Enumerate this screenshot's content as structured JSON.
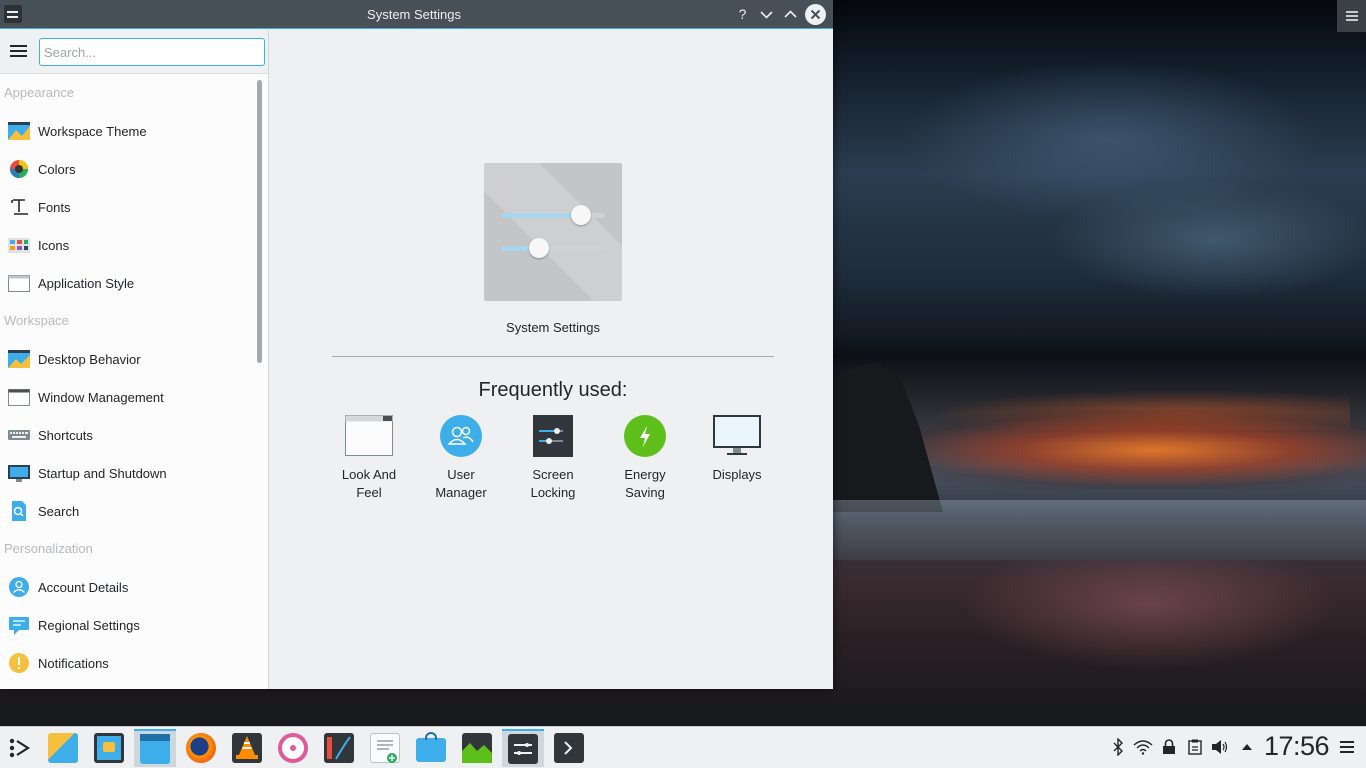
{
  "window": {
    "title": "System Settings",
    "help_glyph": "?",
    "minimize_glyph": "⌄",
    "maximize_glyph": "⌃",
    "close_glyph": "✕"
  },
  "sidebar": {
    "search_placeholder": "Search...",
    "categories": [
      {
        "label": "Appearance",
        "items": [
          "Workspace Theme",
          "Colors",
          "Fonts",
          "Icons",
          "Application Style"
        ]
      },
      {
        "label": "Workspace",
        "items": [
          "Desktop Behavior",
          "Window Management",
          "Shortcuts",
          "Startup and Shutdown",
          "Search"
        ]
      },
      {
        "label": "Personalization",
        "items": [
          "Account Details",
          "Regional Settings",
          "Notifications"
        ]
      }
    ]
  },
  "main": {
    "hero_title": "System Settings",
    "frequently_used_title": "Frequently used:",
    "frequent_items": [
      {
        "line1": "Look And",
        "line2": "Feel"
      },
      {
        "line1": "User",
        "line2": "Manager"
      },
      {
        "line1": "Screen",
        "line2": "Locking"
      },
      {
        "line1": "Energy",
        "line2": "Saving"
      },
      {
        "line1": "Displays",
        "line2": ""
      }
    ]
  },
  "taskbar": {
    "clock": "17:56"
  },
  "colors": {
    "accent": "#3daee9",
    "titlebar": "#475057",
    "window_bg": "#eff0f1"
  }
}
